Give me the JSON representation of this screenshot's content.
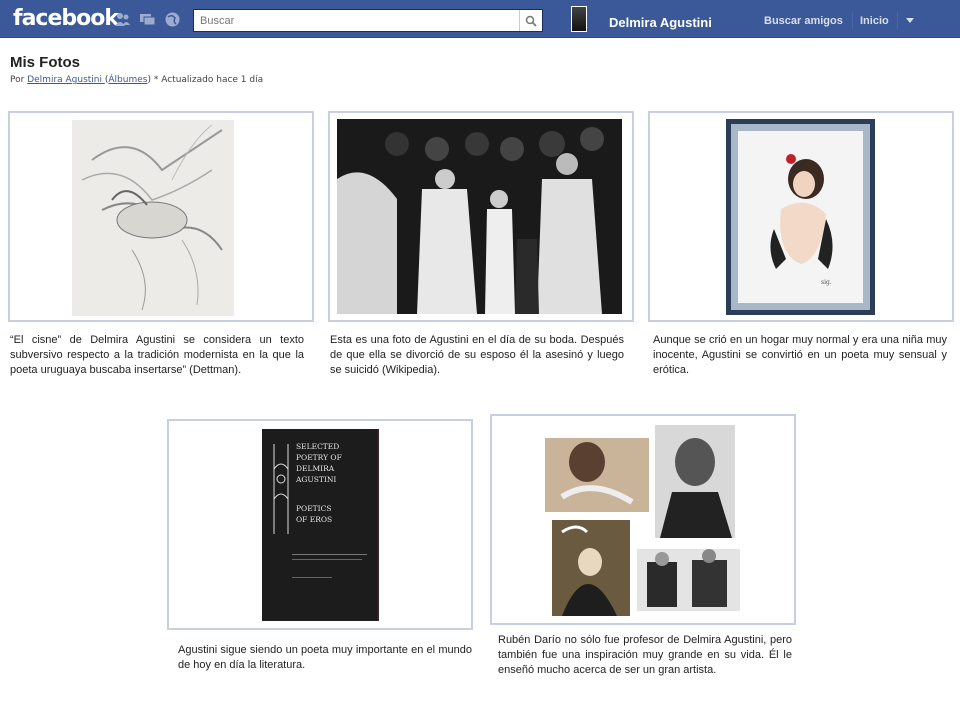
{
  "topbar": {
    "logo": "facebook",
    "search_placeholder": "Buscar",
    "profile_name": "Delmira Agustini",
    "nav_find_friends": "Buscar amigos",
    "nav_home": "Inicio",
    "brand_color": "#3b5998"
  },
  "header": {
    "title": "Mis Fotos",
    "by_prefix": "Por",
    "author_link": "Delmira Agustini ",
    "albums_link": "Álbumes",
    "updated": "* Actualizado hace 1 día"
  },
  "photos": [
    {
      "caption": "“El cisne” de Delmira Agustini se considera un texto subversivo respecto a la tradición modernista en la que la poeta uruguaya buscaba insertarse” (Dettman)."
    },
    {
      "caption": "Esta es una foto de Agustini en el día de su boda. Después de que ella se divorció de su esposo él la asesinó y luego se suicidó (Wikipedia)."
    },
    {
      "caption": "Aunque se crió en un hogar muy normal y era una niña muy inocente, Agustini se convirtió en un poeta muy sensual y erótica."
    },
    {
      "caption": "Agustini sigue siendo un poeta muy importante en el mundo de hoy en día la literatura."
    },
    {
      "caption": "Rubén Darío no sólo fue profesor de Delmira Agustini, pero también fue una inspiración muy grande en su vida. Él le enseñó mucho acerca de ser un gran artista."
    }
  ],
  "book_cover": {
    "line1": "SELECTED",
    "line2": "POETRY OF",
    "line3": "DELMIRA",
    "line4": "AGUSTINI",
    "line5": "POETICS",
    "line6": "OF EROS"
  }
}
